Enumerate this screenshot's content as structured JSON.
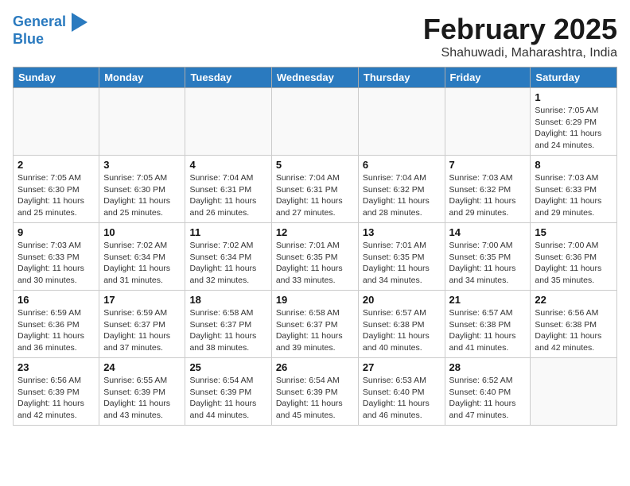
{
  "logo": {
    "line1": "General",
    "line2": "Blue"
  },
  "title": "February 2025",
  "subtitle": "Shahuwadi, Maharashtra, India",
  "headers": [
    "Sunday",
    "Monday",
    "Tuesday",
    "Wednesday",
    "Thursday",
    "Friday",
    "Saturday"
  ],
  "weeks": [
    [
      {
        "day": "",
        "info": ""
      },
      {
        "day": "",
        "info": ""
      },
      {
        "day": "",
        "info": ""
      },
      {
        "day": "",
        "info": ""
      },
      {
        "day": "",
        "info": ""
      },
      {
        "day": "",
        "info": ""
      },
      {
        "day": "1",
        "info": "Sunrise: 7:05 AM\nSunset: 6:29 PM\nDaylight: 11 hours\nand 24 minutes."
      }
    ],
    [
      {
        "day": "2",
        "info": "Sunrise: 7:05 AM\nSunset: 6:30 PM\nDaylight: 11 hours\nand 25 minutes."
      },
      {
        "day": "3",
        "info": "Sunrise: 7:05 AM\nSunset: 6:30 PM\nDaylight: 11 hours\nand 25 minutes."
      },
      {
        "day": "4",
        "info": "Sunrise: 7:04 AM\nSunset: 6:31 PM\nDaylight: 11 hours\nand 26 minutes."
      },
      {
        "day": "5",
        "info": "Sunrise: 7:04 AM\nSunset: 6:31 PM\nDaylight: 11 hours\nand 27 minutes."
      },
      {
        "day": "6",
        "info": "Sunrise: 7:04 AM\nSunset: 6:32 PM\nDaylight: 11 hours\nand 28 minutes."
      },
      {
        "day": "7",
        "info": "Sunrise: 7:03 AM\nSunset: 6:32 PM\nDaylight: 11 hours\nand 29 minutes."
      },
      {
        "day": "8",
        "info": "Sunrise: 7:03 AM\nSunset: 6:33 PM\nDaylight: 11 hours\nand 29 minutes."
      }
    ],
    [
      {
        "day": "9",
        "info": "Sunrise: 7:03 AM\nSunset: 6:33 PM\nDaylight: 11 hours\nand 30 minutes."
      },
      {
        "day": "10",
        "info": "Sunrise: 7:02 AM\nSunset: 6:34 PM\nDaylight: 11 hours\nand 31 minutes."
      },
      {
        "day": "11",
        "info": "Sunrise: 7:02 AM\nSunset: 6:34 PM\nDaylight: 11 hours\nand 32 minutes."
      },
      {
        "day": "12",
        "info": "Sunrise: 7:01 AM\nSunset: 6:35 PM\nDaylight: 11 hours\nand 33 minutes."
      },
      {
        "day": "13",
        "info": "Sunrise: 7:01 AM\nSunset: 6:35 PM\nDaylight: 11 hours\nand 34 minutes."
      },
      {
        "day": "14",
        "info": "Sunrise: 7:00 AM\nSunset: 6:35 PM\nDaylight: 11 hours\nand 34 minutes."
      },
      {
        "day": "15",
        "info": "Sunrise: 7:00 AM\nSunset: 6:36 PM\nDaylight: 11 hours\nand 35 minutes."
      }
    ],
    [
      {
        "day": "16",
        "info": "Sunrise: 6:59 AM\nSunset: 6:36 PM\nDaylight: 11 hours\nand 36 minutes."
      },
      {
        "day": "17",
        "info": "Sunrise: 6:59 AM\nSunset: 6:37 PM\nDaylight: 11 hours\nand 37 minutes."
      },
      {
        "day": "18",
        "info": "Sunrise: 6:58 AM\nSunset: 6:37 PM\nDaylight: 11 hours\nand 38 minutes."
      },
      {
        "day": "19",
        "info": "Sunrise: 6:58 AM\nSunset: 6:37 PM\nDaylight: 11 hours\nand 39 minutes."
      },
      {
        "day": "20",
        "info": "Sunrise: 6:57 AM\nSunset: 6:38 PM\nDaylight: 11 hours\nand 40 minutes."
      },
      {
        "day": "21",
        "info": "Sunrise: 6:57 AM\nSunset: 6:38 PM\nDaylight: 11 hours\nand 41 minutes."
      },
      {
        "day": "22",
        "info": "Sunrise: 6:56 AM\nSunset: 6:38 PM\nDaylight: 11 hours\nand 42 minutes."
      }
    ],
    [
      {
        "day": "23",
        "info": "Sunrise: 6:56 AM\nSunset: 6:39 PM\nDaylight: 11 hours\nand 42 minutes."
      },
      {
        "day": "24",
        "info": "Sunrise: 6:55 AM\nSunset: 6:39 PM\nDaylight: 11 hours\nand 43 minutes."
      },
      {
        "day": "25",
        "info": "Sunrise: 6:54 AM\nSunset: 6:39 PM\nDaylight: 11 hours\nand 44 minutes."
      },
      {
        "day": "26",
        "info": "Sunrise: 6:54 AM\nSunset: 6:39 PM\nDaylight: 11 hours\nand 45 minutes."
      },
      {
        "day": "27",
        "info": "Sunrise: 6:53 AM\nSunset: 6:40 PM\nDaylight: 11 hours\nand 46 minutes."
      },
      {
        "day": "28",
        "info": "Sunrise: 6:52 AM\nSunset: 6:40 PM\nDaylight: 11 hours\nand 47 minutes."
      },
      {
        "day": "",
        "info": ""
      }
    ]
  ]
}
